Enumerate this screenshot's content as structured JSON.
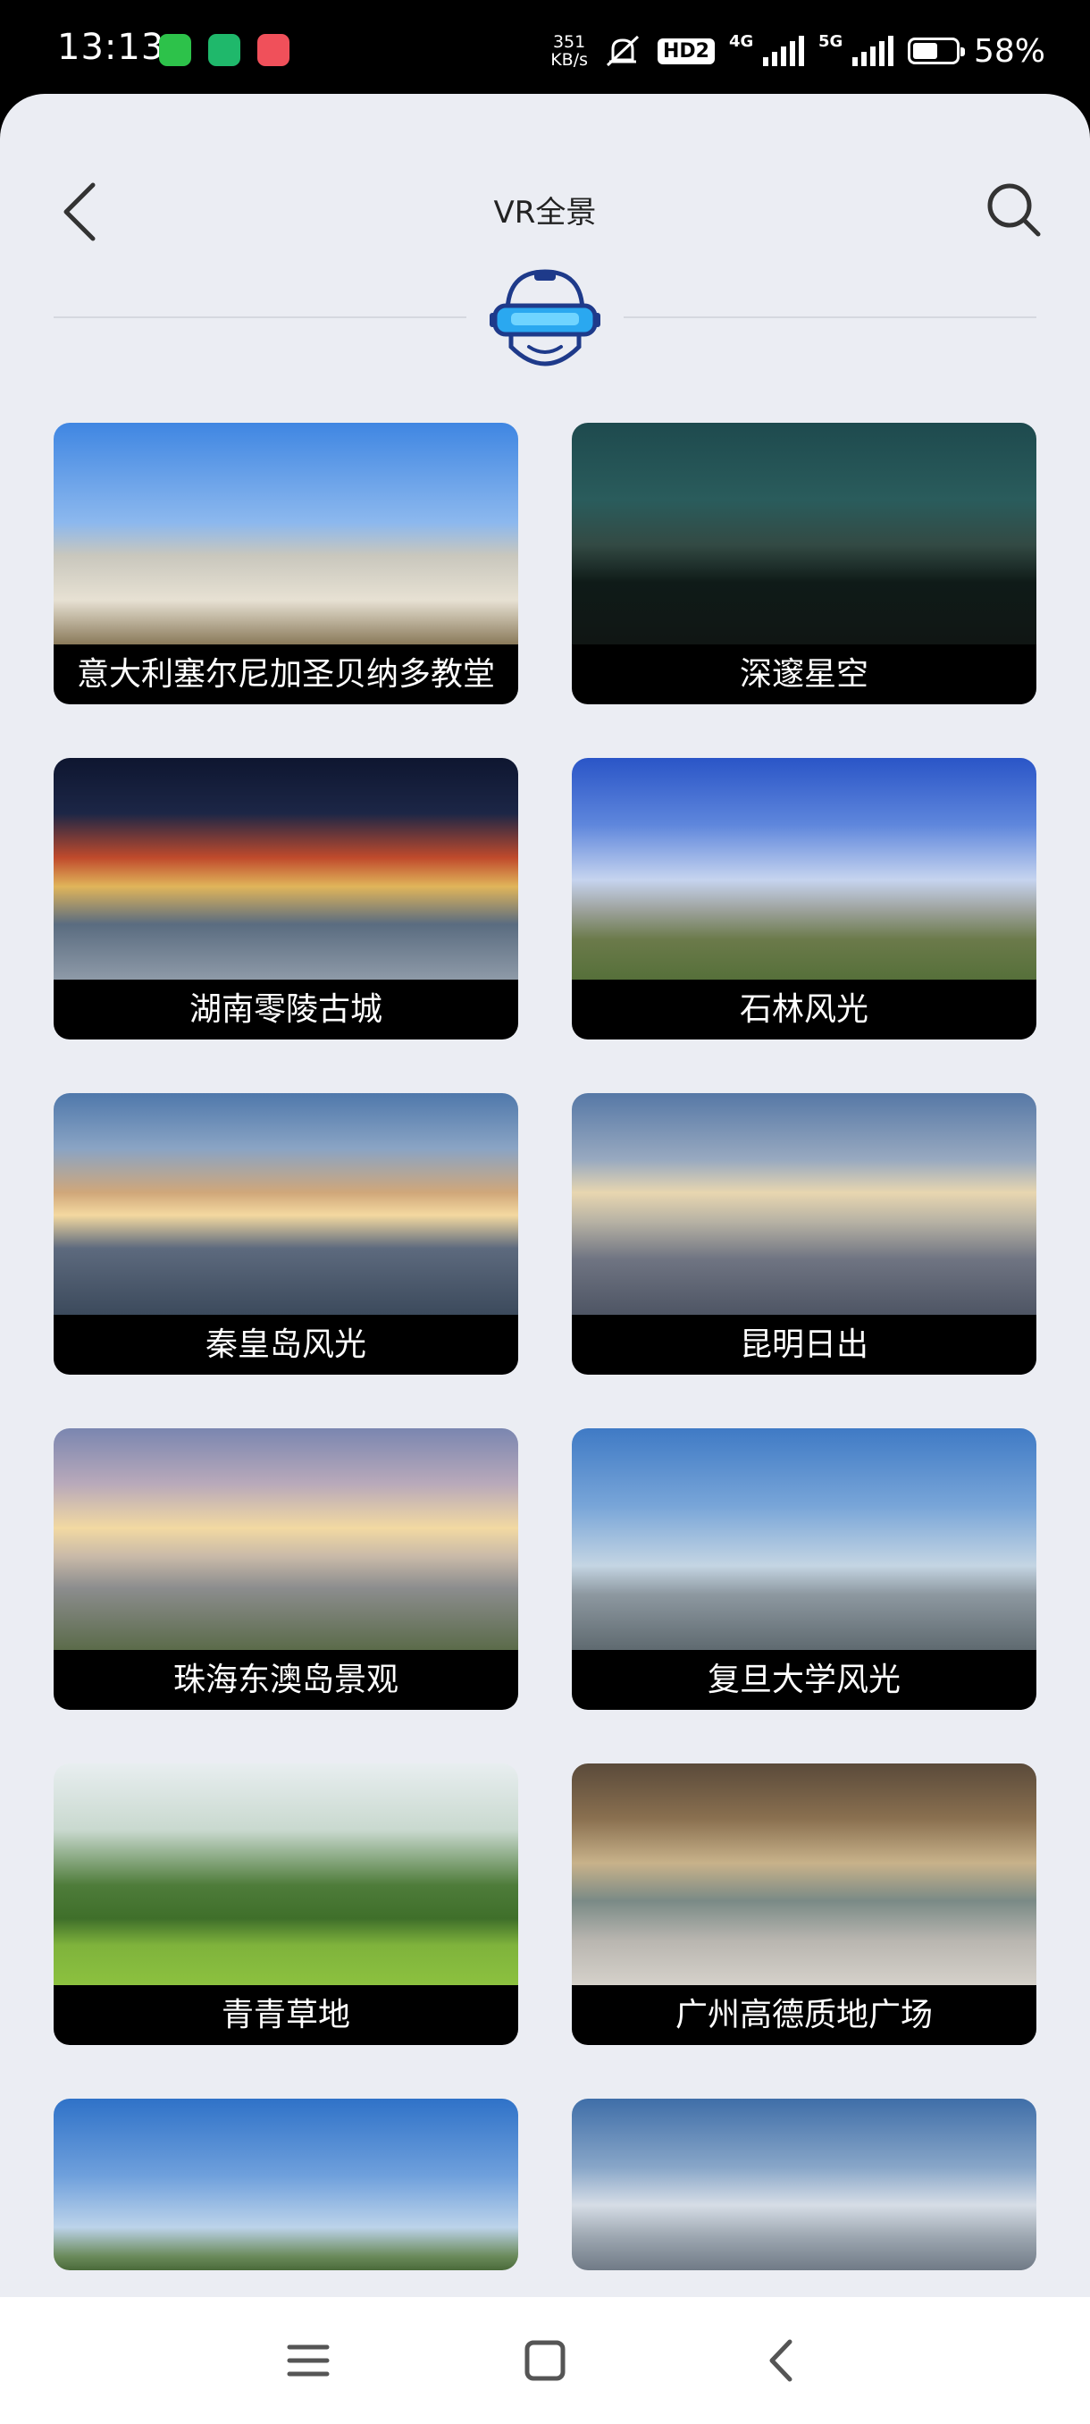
{
  "status_bar": {
    "time": "13:13",
    "net_speed_value": "351",
    "net_speed_unit": "KB/s",
    "hd_badge": "HD2",
    "network_1": "4G",
    "network_2": "5G",
    "battery_percent": "58%",
    "battery_level": 0.58
  },
  "header": {
    "title": "VR全景",
    "back_icon": "chevron-left-icon",
    "search_icon": "search-icon",
    "logo_icon": "vr-headset-icon",
    "accent_color": "#1e88e5"
  },
  "items": [
    {
      "title": "意大利塞尔尼加圣贝纳多教堂"
    },
    {
      "title": "深邃星空"
    },
    {
      "title": "湖南零陵古城"
    },
    {
      "title": "石林风光"
    },
    {
      "title": "秦皇岛风光"
    },
    {
      "title": "昆明日出"
    },
    {
      "title": "珠海东澳岛景观"
    },
    {
      "title": "复旦大学风光"
    },
    {
      "title": "青青草地"
    },
    {
      "title": "广州高德质地广场"
    },
    {
      "title": ""
    },
    {
      "title": ""
    }
  ],
  "nav_bar": {
    "menu_icon": "menu-icon",
    "home_icon": "home-square-icon",
    "back_icon": "back-triangle-icon"
  }
}
